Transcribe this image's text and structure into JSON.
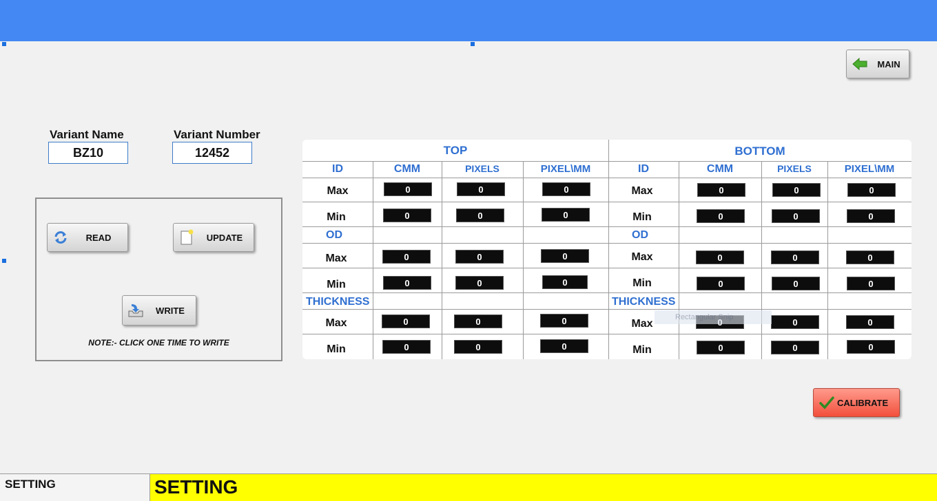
{
  "header": {
    "color": "#4488f4"
  },
  "nav": {
    "main_label": "MAIN"
  },
  "variant": {
    "name_label": "Variant Name",
    "name_value": "BZ10",
    "number_label": "Variant Number",
    "number_value": "12452"
  },
  "actions": {
    "read_label": "READ",
    "update_label": "UPDATE",
    "write_label": "WRITE",
    "note": "NOTE:- CLICK ONE TIME TO WRITE",
    "calibrate_label": "CALIBRATE"
  },
  "table": {
    "top_title": "TOP",
    "bottom_title": "BOTTOM",
    "columns": [
      "ID",
      "CMM",
      "PIXELS",
      "PIXEL\\MM"
    ],
    "sections": [
      "OD",
      "THICKNESS"
    ],
    "row_labels": [
      "Max",
      "Min"
    ],
    "top": {
      "id_max": [
        "0",
        "0",
        "0"
      ],
      "id_min": [
        "0",
        "0",
        "0"
      ],
      "od_max": [
        "0",
        "0",
        "0"
      ],
      "od_min": [
        "0",
        "0",
        "0"
      ],
      "th_max": [
        "0",
        "0",
        "0"
      ],
      "th_min": [
        "0",
        "0",
        "0"
      ]
    },
    "bottom": {
      "id_max": [
        "0",
        "0",
        "0"
      ],
      "id_min": [
        "0",
        "0",
        "0"
      ],
      "od_max": [
        "0",
        "0",
        "0"
      ],
      "od_min": [
        "0",
        "0",
        "0"
      ],
      "th_max": [
        "0",
        "0",
        "0"
      ],
      "th_min": [
        "0",
        "0",
        "0"
      ]
    }
  },
  "overlay": {
    "snip_text": "Rectangular Snip"
  },
  "status": {
    "left": "SETTING",
    "right": "SETTING",
    "right_color": "#ffff00"
  }
}
